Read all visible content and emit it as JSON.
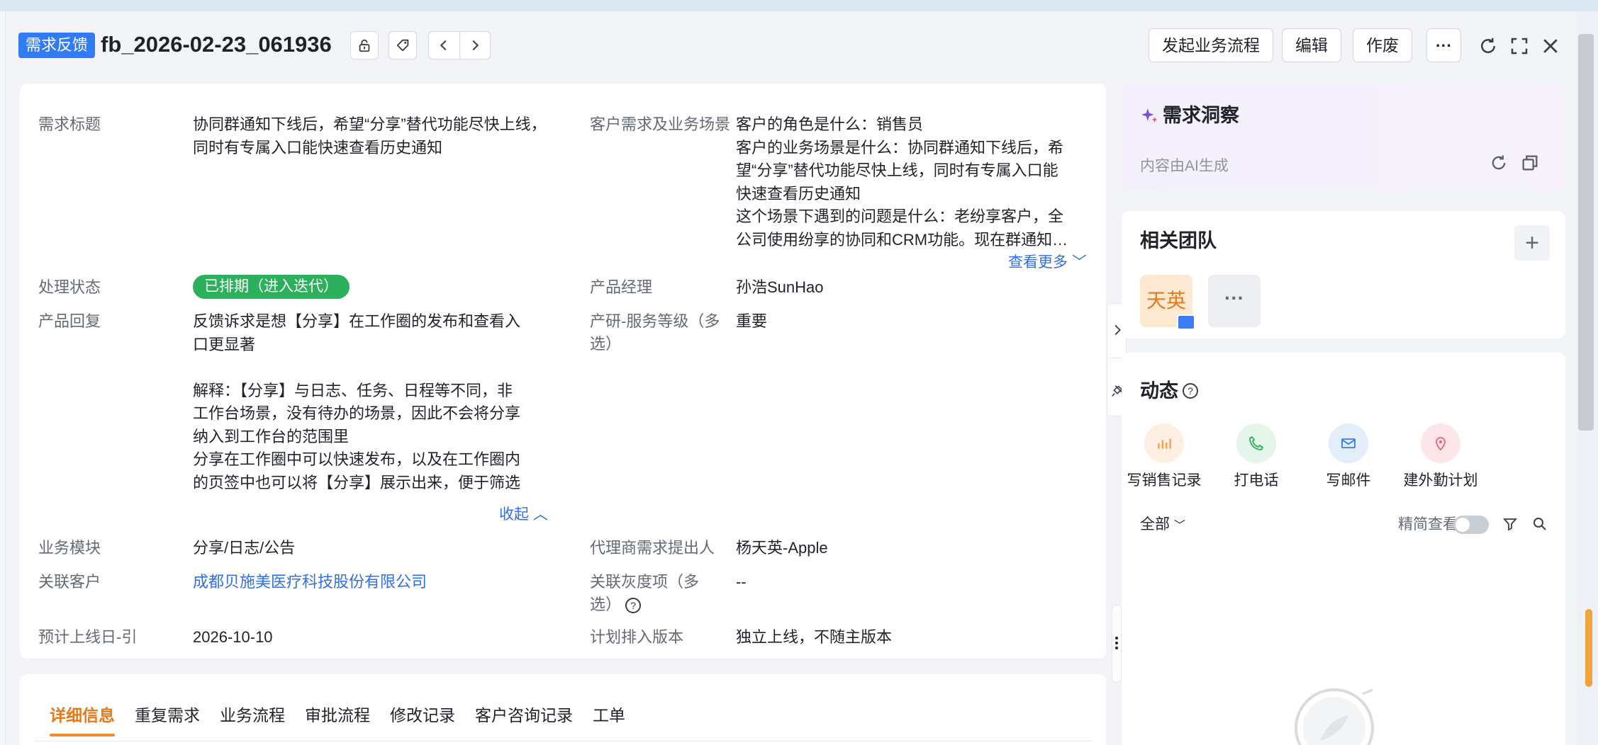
{
  "header": {
    "type_badge": "需求反馈",
    "record_id": "fb_2026-02-23_061936",
    "actions": {
      "start_flow": "发起业务流程",
      "edit": "编辑",
      "void": "作废",
      "more": "···"
    }
  },
  "fields": {
    "title_label": "需求标题",
    "title_value": "协同群通知下线后，希望“分享”替代功能尽快上线，同时有专属入口能快速查看历史通知",
    "scenario_label": "客户需求及业务场景",
    "scenario_lines": [
      "客户的角色是什么：销售员",
      "客户的业务场景是什么：协同群通知下线后，希",
      "望“分享”替代功能尽快上线，同时有专属入口能",
      "快速查看历史通知",
      "这个场景下遇到的问题是什么：老纷享客户，全",
      "公司使用纷享的协同和CRM功能。现在群通知…"
    ],
    "see_more": "查看更多",
    "status_label": "处理状态",
    "status_value": "已排期（进入迭代）",
    "pm_label": "产品经理",
    "pm_value": "孙浩SunHao",
    "reply_label": "产品回复",
    "reply_lines": [
      "反馈诉求是想【分享】在工作圈的发布和查看入",
      "口更显著",
      "",
      "解释：【分享】与日志、任务、日程等不同，非",
      "工作台场景，没有待办的场景，因此不会将分享",
      "纳入到工作台的范围里",
      "分享在工作圈中可以快速发布，以及在工作圈内",
      "的页签中也可以将【分享】展示出来，便于筛选"
    ],
    "collapse": "收起",
    "service_label_line1": "产研-服务等级（多",
    "service_label_line2": "选）",
    "service_value": "重要",
    "module_label": "业务模块",
    "module_value": "分享/日志/公告",
    "agent_label": "代理商需求提出人",
    "agent_value": "杨天英-Apple",
    "customer_label": "关联客户",
    "customer_value": "成都贝施美医疗科技股份有限公司",
    "gray_label_line1": "关联灰度项（多",
    "gray_label_line2": "选）",
    "gray_value": "--",
    "launch_label": "预计上线日-引",
    "launch_value": "2026-10-10",
    "version_label": "计划排入版本",
    "version_value": "独立上线，不随主版本"
  },
  "tabs": [
    {
      "label": "详细信息",
      "active": true
    },
    {
      "label": "重复需求",
      "active": false
    },
    {
      "label": "业务流程",
      "active": false
    },
    {
      "label": "审批流程",
      "active": false
    },
    {
      "label": "修改记录",
      "active": false
    },
    {
      "label": "客户咨询记录",
      "active": false
    },
    {
      "label": "工单",
      "active": false
    }
  ],
  "insight": {
    "title": "需求洞察",
    "subtitle": "内容由AI生成"
  },
  "team": {
    "title": "相关团队",
    "avatar_text": "天英",
    "more": "···"
  },
  "activity": {
    "title": "动态",
    "actions": [
      {
        "label": "写销售记录",
        "icon": "sales-record-icon",
        "color": "#f5a14a",
        "bg": "#fdf0e3"
      },
      {
        "label": "打电话",
        "icon": "phone-icon",
        "color": "#2bb05b",
        "bg": "#e4f6ea"
      },
      {
        "label": "写邮件",
        "icon": "mail-icon",
        "color": "#2f7cf6",
        "bg": "#e3eefd"
      },
      {
        "label": "建外勤计划",
        "icon": "location-icon",
        "color": "#ef5d73",
        "bg": "#fde6ea"
      }
    ],
    "filter_all": "全部",
    "simple_view": "精简查看"
  },
  "colors": {
    "primary": "#2f7cf6",
    "status_green": "#2bb05b",
    "tab_active": "#e5791c",
    "link": "#2f6fe8"
  }
}
